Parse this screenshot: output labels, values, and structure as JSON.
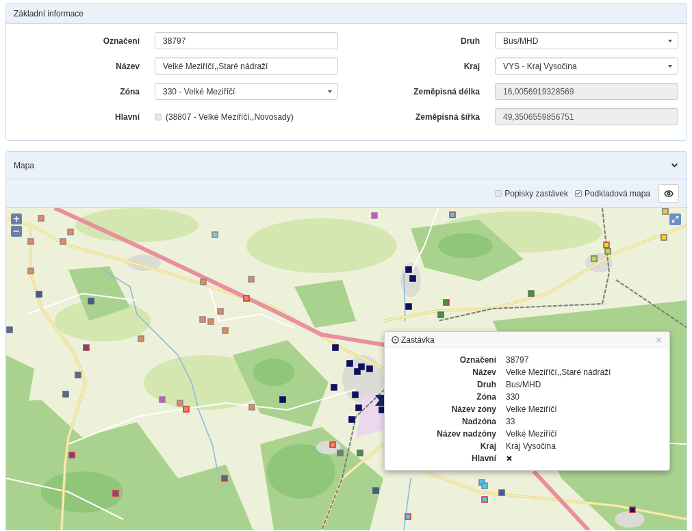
{
  "basic_info": {
    "title": "Základní informace",
    "left_fields": [
      {
        "kind": "text",
        "label": "Označení",
        "value": "38797",
        "disabled": false
      },
      {
        "kind": "text",
        "label": "Název",
        "value": "Velké Meziříčí,,Staré nádraží",
        "disabled": false
      },
      {
        "kind": "select",
        "label": "Zóna",
        "value": "330 - Velké Meziříčí",
        "disabled": false
      },
      {
        "kind": "checkbox",
        "label": "Hlavní",
        "value": "(38807 - Velké Meziříčí,,Novosady)",
        "checked": false
      }
    ],
    "right_fields": [
      {
        "kind": "select",
        "label": "Druh",
        "value": "Bus/MHD",
        "disabled": false
      },
      {
        "kind": "select",
        "label": "Kraj",
        "value": "VYS - Kraj Vysočina",
        "disabled": false
      },
      {
        "kind": "text",
        "label": "Zeměpisná délka",
        "value": "16,0056919328569",
        "disabled": true
      },
      {
        "kind": "text",
        "label": "Zeměpisná šířka",
        "value": "49,3506559856751",
        "disabled": true
      }
    ]
  },
  "map_panel": {
    "title": "Mapa",
    "options": [
      {
        "label": "Popisky zastávek",
        "checked": false
      },
      {
        "label": "Podkladová mapa",
        "checked": true
      }
    ],
    "map": {
      "zoom_in": "+",
      "zoom_out": "−"
    },
    "popup": {
      "title": "Zastávka",
      "close": "×",
      "rows": [
        {
          "kind": "text",
          "label": "Označení",
          "value": "38797"
        },
        {
          "kind": "text",
          "label": "Název",
          "value": "Velké Meziříčí,,Staré nádraží"
        },
        {
          "kind": "text",
          "label": "Druh",
          "value": "Bus/MHD"
        },
        {
          "kind": "text",
          "label": "Zóna",
          "value": "330"
        },
        {
          "kind": "text",
          "label": "Název zóny",
          "value": "Velké Meziříčí"
        },
        {
          "kind": "text",
          "label": "Nadzóna",
          "value": "33"
        },
        {
          "kind": "text",
          "label": "Název nadzóny",
          "value": "Velké Meziříčí"
        },
        {
          "kind": "text",
          "label": "Kraj",
          "value": "Kraj Vysočina"
        },
        {
          "kind": "flag",
          "label": "Hlavní",
          "value": false
        }
      ]
    }
  }
}
